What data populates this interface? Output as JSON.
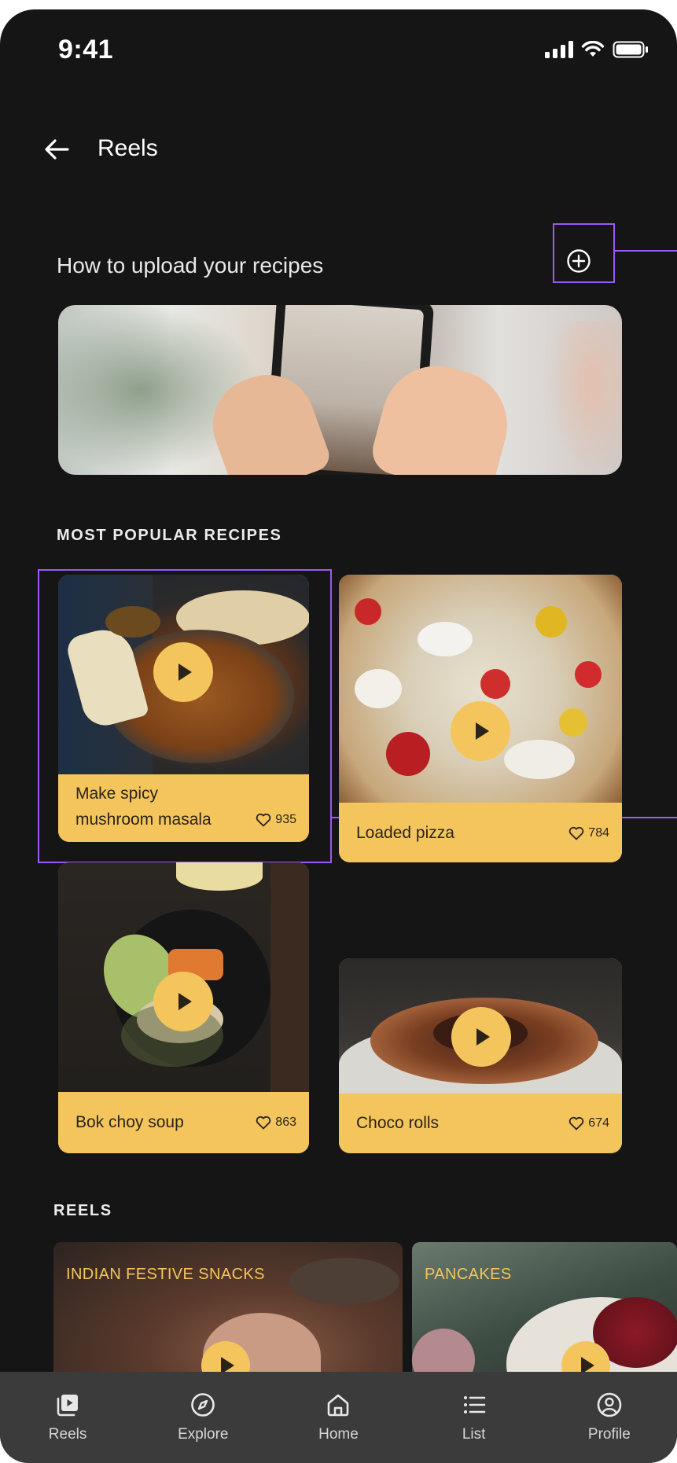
{
  "status_bar": {
    "time": "9:41"
  },
  "header": {
    "title": "Reels",
    "back_icon": "arrow-left-icon"
  },
  "upload": {
    "title": "How to upload your recipes",
    "add_icon": "plus-circle-icon"
  },
  "sections": {
    "popular": "MOST POPULAR RECIPES",
    "reels": "REELS"
  },
  "recipes": [
    {
      "title_line1": "Make spicy",
      "title_line2": "mushroom masala",
      "likes": "935"
    },
    {
      "title": "Loaded pizza",
      "likes": "784"
    },
    {
      "title": "Bok choy soup",
      "likes": "863"
    },
    {
      "title": "Choco rolls",
      "likes": "674"
    }
  ],
  "reels": [
    {
      "title": "INDIAN FESTIVE SNACKS"
    },
    {
      "title": "PANCAKES"
    }
  ],
  "nav": [
    {
      "label": "Reels",
      "icon": "reels-icon"
    },
    {
      "label": "Explore",
      "icon": "compass-icon"
    },
    {
      "label": "Home",
      "icon": "home-icon"
    },
    {
      "label": "List",
      "icon": "list-icon"
    },
    {
      "label": "Profile",
      "icon": "profile-icon"
    }
  ],
  "colors": {
    "background": "#161516",
    "accent": "#f5c55d",
    "selection": "#9b59f5",
    "nav_background": "#3b3b3b"
  }
}
